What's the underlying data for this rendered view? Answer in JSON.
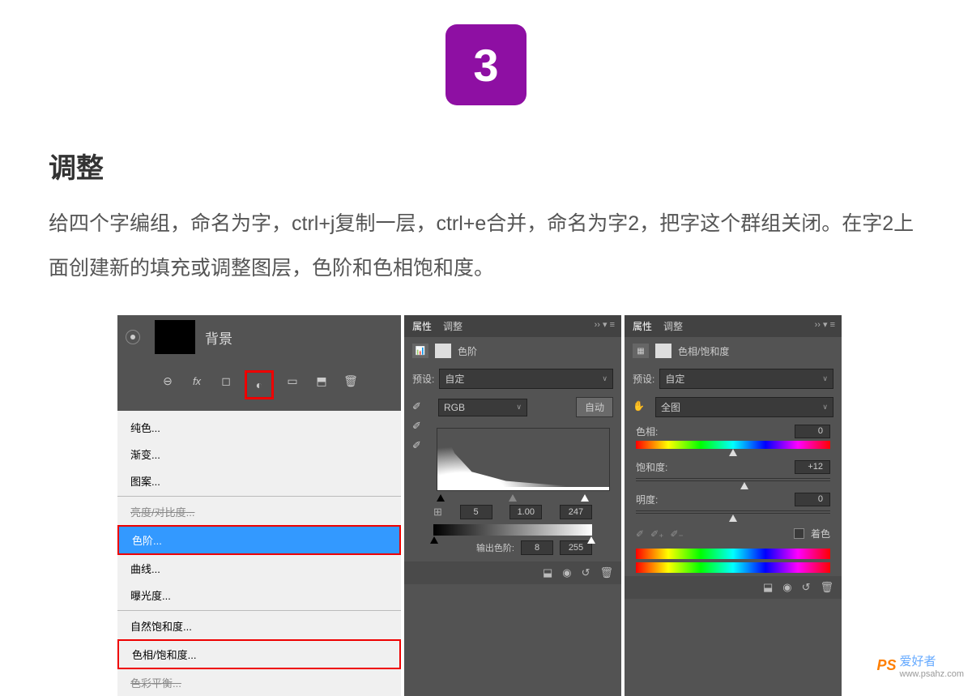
{
  "step": "3",
  "title": "调整",
  "description": "给四个字编组，命名为字，ctrl+j复制一层，ctrl+e合并，命名为字2，把字这个群组关闭。在字2上面创建新的填充或调整图层，色阶和色相饱和度。",
  "panel1": {
    "layer_name": "背景",
    "menu": {
      "items": [
        "纯色...",
        "渐变...",
        "图案..."
      ],
      "items2_partial": "亮度/对比度...",
      "levels": "色阶...",
      "curves": "曲线...",
      "exposure": "曝光度...",
      "natural_sat": "自然饱和度...",
      "hue_sat": "色相/饱和度...",
      "color_balance_partial": "色彩平衡..."
    }
  },
  "panel2": {
    "tabs": {
      "properties": "属性",
      "adjust": "调整"
    },
    "header": "色阶",
    "preset_label": "预设:",
    "preset_value": "自定",
    "channel": "RGB",
    "auto": "自动",
    "input_shadow": "5",
    "input_mid": "1.00",
    "input_hilite": "247",
    "output_label": "输出色阶:",
    "output_shadow": "8",
    "output_hilite": "255"
  },
  "panel3": {
    "tabs": {
      "properties": "属性",
      "adjust": "调整"
    },
    "header": "色相/饱和度",
    "preset_label": "预设:",
    "preset_value": "自定",
    "range": "全图",
    "hue_label": "色相:",
    "hue_value": "0",
    "sat_label": "饱和度:",
    "sat_value": "+12",
    "light_label": "明度:",
    "light_value": "0",
    "colorize": "着色"
  },
  "watermark": {
    "brand": "PS",
    "cn": "爱好者",
    "url": "www.psahz.com"
  }
}
